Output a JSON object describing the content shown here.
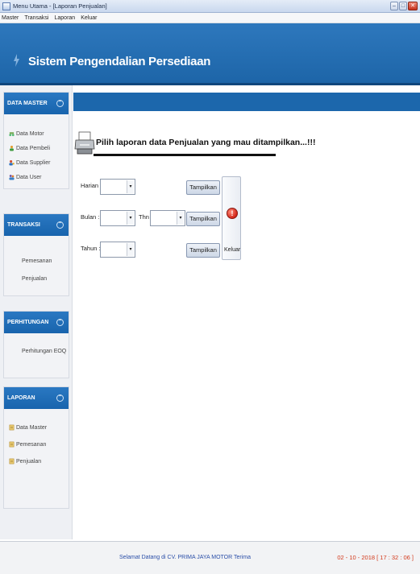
{
  "window": {
    "title": "Menu Utama - [Laporan Penjualan]",
    "controls": {
      "minimize": "–",
      "maximize": "□",
      "close": "✕"
    }
  },
  "menubar": {
    "items": [
      "Master",
      "Transaksi",
      "Laporan",
      "Keluar"
    ]
  },
  "banner": {
    "title": "Sistem Pengendalian Persediaan",
    "icon": "lightning-icon"
  },
  "sidebar": {
    "toggle_glyph": "⌃",
    "panels": [
      {
        "title": "DATA MASTER",
        "items": [
          {
            "label": "Data Motor",
            "icon": "motor-icon"
          },
          {
            "label": "Data Pembeli",
            "icon": "person-icon"
          },
          {
            "label": "Data Supplier",
            "icon": "supplier-icon"
          },
          {
            "label": "Data User",
            "icon": "users-icon"
          }
        ]
      },
      {
        "title": "TRANSAKSI",
        "items": [
          {
            "label": "Pemesanan"
          },
          {
            "label": "Penjualan"
          }
        ]
      },
      {
        "title": "PERHITUNGAN",
        "items": [
          {
            "label": "Perhitungan EOQ"
          }
        ]
      },
      {
        "title": "LAPORAN",
        "items": [
          {
            "label": "Data Master",
            "icon": "report-icon"
          },
          {
            "label": "Pemesanan",
            "icon": "report-icon"
          },
          {
            "label": "Penjualan",
            "icon": "report-icon"
          }
        ]
      }
    ]
  },
  "main": {
    "heading": "Pilih laporan data Penjualan yang mau ditampilkan...!!!",
    "form": {
      "harian_label": "Harian :",
      "bulan_label": "Bulan  :",
      "thn_label": "Thn",
      "tahun_label": "Tahun  :",
      "harian_value": "",
      "bulan_value": "",
      "thn_value": "",
      "tahun_value": "",
      "tampilkan_label": "Tampilkan",
      "keluar_label": "Keluar",
      "dropdown_glyph": "▾",
      "stop_glyph": "!"
    }
  },
  "statusbar": {
    "welcome": "Selamat Datang di CV. PRIMA JAYA MOTOR Terima",
    "datetime": "02 - 10 - 2018 [ 17 : 32 : 06 ]"
  },
  "colors": {
    "banner": "#1f68ab",
    "panel_header": "#1f6db5",
    "status_time": "#d33a1c",
    "status_welcome": "#2b4fa8"
  }
}
